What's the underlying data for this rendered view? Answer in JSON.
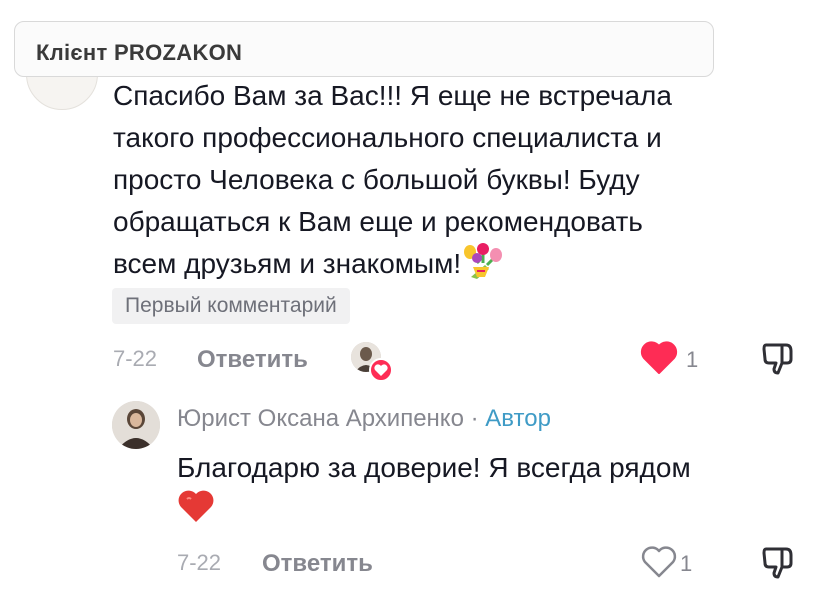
{
  "client_label": "Клієнт PROZAKON",
  "comment": {
    "lines": [
      "Спасибо Вам за Вас!!! Я еще не встречала",
      "такого профессионального специалиста и",
      "просто Человека с большой буквы! Буду",
      "обращаться к Вам еще и рекомендовать",
      "всем друзьям и знакомым!"
    ],
    "badge": "Первый комментарий",
    "date": "7-22",
    "reply_label": "Ответить",
    "like_count": "1",
    "liked": true
  },
  "reply": {
    "author": "Юрист Оксана Архипенко",
    "separator": "·",
    "author_tag": "Автор",
    "lines": [
      "Благодарю за доверие! Я всегда рядом"
    ],
    "date": "7-22",
    "reply_label": "Ответить",
    "like_count": "1",
    "liked": false
  },
  "colors": {
    "like_active": "#fe2c55",
    "author_tag": "#3f9bc6",
    "meta_text": "#86878f"
  },
  "icons": [
    "flowers-emoji-icon",
    "heart-filled-icon",
    "heart-outline-icon",
    "dislike-icon",
    "red-heart-emoji-icon"
  ]
}
